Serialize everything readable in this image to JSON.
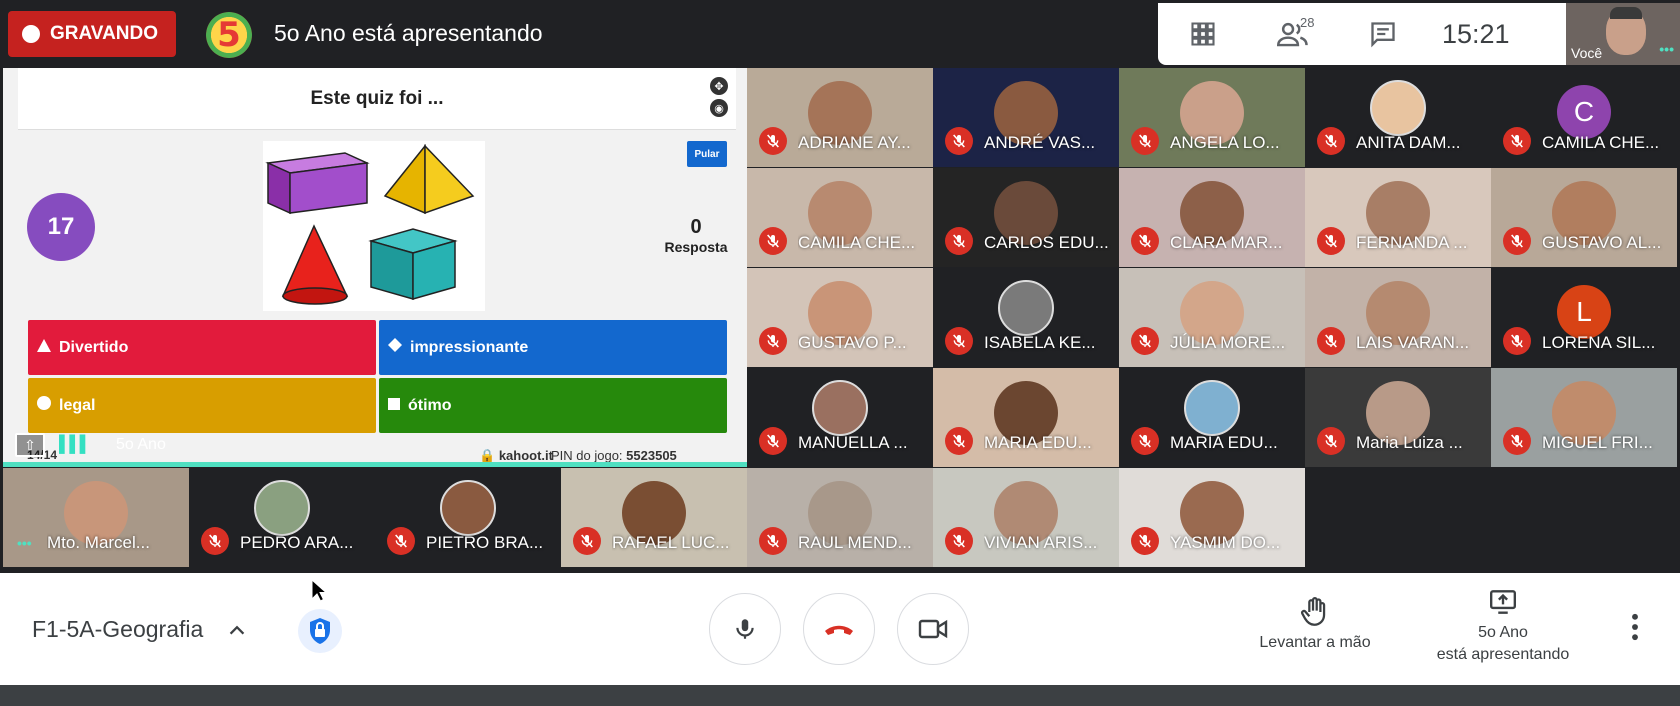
{
  "recording": {
    "label": "GRAVANDO"
  },
  "presenter": {
    "avatar_text": "5",
    "title": "5o Ano está apresentando"
  },
  "toolbar": {
    "people_count": "28",
    "clock": "15:21",
    "self_label": "Você"
  },
  "quiz": {
    "question": "Este quiz foi ...",
    "timer": "17",
    "skip_label": "Pular",
    "answers_count": "0",
    "answers_label": "Resposta",
    "answers": [
      {
        "label": "Divertido",
        "color": "#e21b3c",
        "shape": "triangle"
      },
      {
        "label": "impressionante",
        "color": "#1368ce",
        "shape": "diamond"
      },
      {
        "label": "legal",
        "color": "#d89e00",
        "shape": "circle"
      },
      {
        "label": "ótimo",
        "color": "#26890c",
        "shape": "square"
      }
    ],
    "progress": "14/14",
    "host": "kahoot.it",
    "pin_label": "PIN do jogo:",
    "pin": "5523505"
  },
  "presentation_label": "5o Ano",
  "participants": [
    {
      "name": "ADRIANE AY..."
    },
    {
      "name": "ANDRÉ VAS..."
    },
    {
      "name": "ANGELA LO..."
    },
    {
      "name": "ANITA DAM..."
    },
    {
      "name": "CAMILA CHE...",
      "initial": "C"
    },
    {
      "name": "CAMILA CHE..."
    },
    {
      "name": "CARLOS EDU..."
    },
    {
      "name": "CLARA MAR..."
    },
    {
      "name": "FERNANDA ..."
    },
    {
      "name": "GUSTAVO AL..."
    },
    {
      "name": "GUSTAVO P..."
    },
    {
      "name": "ISABELA KE..."
    },
    {
      "name": "JÚLIA MORE..."
    },
    {
      "name": "LAIS VARAN..."
    },
    {
      "name": "LORENA SIL...",
      "initial": "L"
    },
    {
      "name": "MANUELLA ..."
    },
    {
      "name": "MARIA EDU..."
    },
    {
      "name": "MARIA EDU..."
    },
    {
      "name": "Maria Luiza ..."
    },
    {
      "name": "MIGUEL FRI..."
    },
    {
      "name": "Mto. Marcel..."
    },
    {
      "name": "PEDRO ARA..."
    },
    {
      "name": "PIETRO BRA..."
    },
    {
      "name": "RAFAEL LUC..."
    },
    {
      "name": "RAUL MEND..."
    },
    {
      "name": "VIVIAN ARIS..."
    },
    {
      "name": "YASMIM DO..."
    }
  ],
  "bottom": {
    "meeting_name": "F1-5A-Geografia",
    "raise_hand": "Levantar a mão",
    "presenting_line1": "5o Ano",
    "presenting_line2": "está apresentando"
  },
  "colors": {
    "record": "#c5221f",
    "mic_off": "#d93025",
    "active_speaker": "#4fe0c1",
    "hangup": "#d93025"
  }
}
